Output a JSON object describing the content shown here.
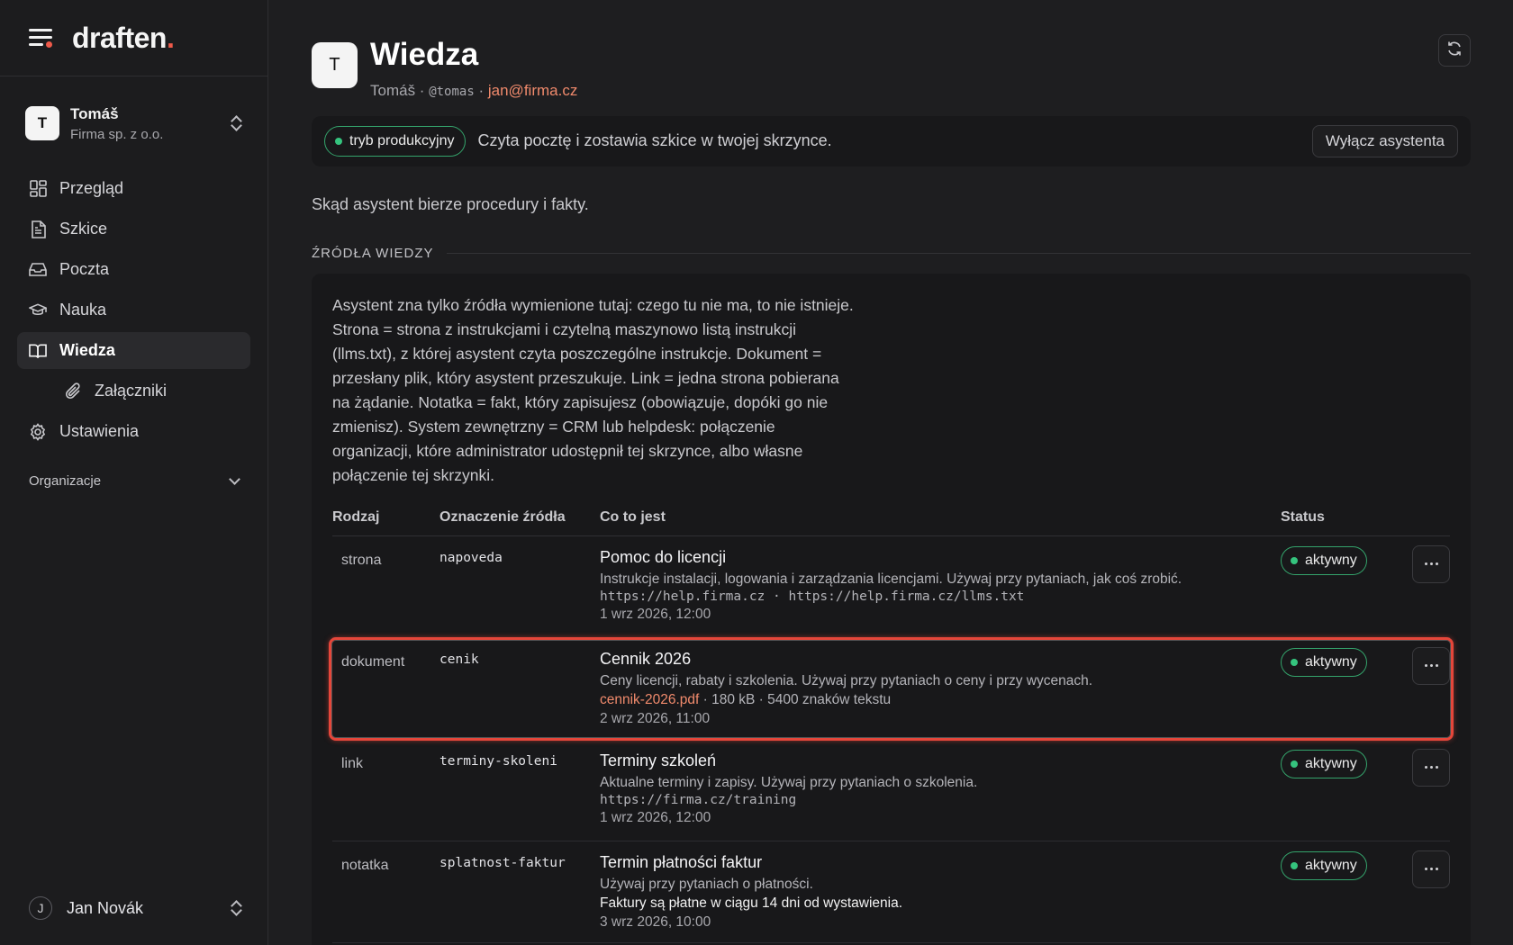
{
  "brand": {
    "name": "draften",
    "dot": "."
  },
  "account": {
    "initial": "T",
    "name": "Tomáš",
    "org": "Firma sp. z o.o."
  },
  "nav": {
    "items": [
      {
        "label": "Przegląd",
        "icon": "grid-icon"
      },
      {
        "label": "Szkice",
        "icon": "document-icon"
      },
      {
        "label": "Poczta",
        "icon": "inbox-icon"
      },
      {
        "label": "Nauka",
        "icon": "graduation-cap-icon"
      },
      {
        "label": "Wiedza",
        "icon": "book-icon",
        "active": true
      },
      {
        "label": "Załączniki",
        "icon": "paperclip-icon",
        "sub": true
      },
      {
        "label": "Ustawienia",
        "icon": "gear-icon"
      }
    ],
    "organizations_label": "Organizacje"
  },
  "user": {
    "initial": "J",
    "name": "Jan Novák"
  },
  "header": {
    "initial": "T",
    "title": "Wiedza",
    "name": "Tomáš",
    "sep": " · ",
    "handle": "@tomas",
    "email": "jan@firma.cz"
  },
  "mode": {
    "badge": "tryb produkcyjny",
    "description": "Czyta pocztę i zostawia szkice w twojej skrzynce.",
    "disable_button": "Wyłącz asystenta"
  },
  "lead": "Skąd asystent bierze procedury i fakty.",
  "section_title": "ŹRÓDŁA WIEDZY",
  "intro": "Asystent zna tylko źródła wymienione tutaj: czego tu nie ma, to nie istnieje. Strona = strona z instrukcjami i czytelną maszynowo listą instrukcji (llms.txt), z której asystent czyta poszczególne instrukcje. Dokument = przesłany plik, który asystent przeszukuje. Link = jedna strona pobierana na żądanie. Notatka = fakt, który zapisujesz (obowiązuje, dopóki go nie zmienisz). System zewnętrzny = CRM lub helpdesk: połączenie organizacji, które administrator udostępnił tej skrzynce, albo własne połączenie tej skrzynki.",
  "table": {
    "headers": {
      "kind": "Rodzaj",
      "id": "Oznaczenie źródła",
      "what": "Co to jest",
      "status": "Status"
    },
    "rows": [
      {
        "kind": "strona",
        "id": "napoveda",
        "title": "Pomoc do licencji",
        "desc": "Instrukcje instalacji, logowania i zarządzania licencjami. Używaj przy pytaniach, jak coś zrobić.",
        "mono": "https://help.firma.cz · https://help.firma.cz/llms.txt",
        "date": "1 wrz 2026, 12:00",
        "status": "aktywny"
      },
      {
        "kind": "dokument",
        "id": "cenik",
        "title": "Cennik 2026",
        "desc": "Ceny licencji, rabaty i szkolenia. Używaj przy pytaniach o ceny i przy wycenach.",
        "file": "cennik-2026.pdf",
        "file_meta": " · 180 kB · 5400 znaków tekstu",
        "date": "2 wrz 2026, 11:00",
        "status": "aktywny"
      },
      {
        "kind": "link",
        "id": "terminy-skoleni",
        "title": "Terminy szkoleń",
        "desc": "Aktualne terminy i zapisy. Używaj przy pytaniach o szkolenia.",
        "mono": "https://firma.cz/training",
        "date": "1 wrz 2026, 12:00",
        "status": "aktywny"
      },
      {
        "kind": "notatka",
        "id": "splatnost-faktur",
        "title": "Termin płatności faktur",
        "desc": "Używaj przy pytaniach o płatności.",
        "fact": "Faktury są płatne w ciągu 14 dni od wystawienia.",
        "date": "3 wrz 2026, 10:00",
        "status": "aktywny"
      }
    ]
  },
  "colors": {
    "accent": "#ef5a4a",
    "status_green": "#35c47e",
    "highlight": "#e5463a",
    "link": "#f08a6c"
  }
}
